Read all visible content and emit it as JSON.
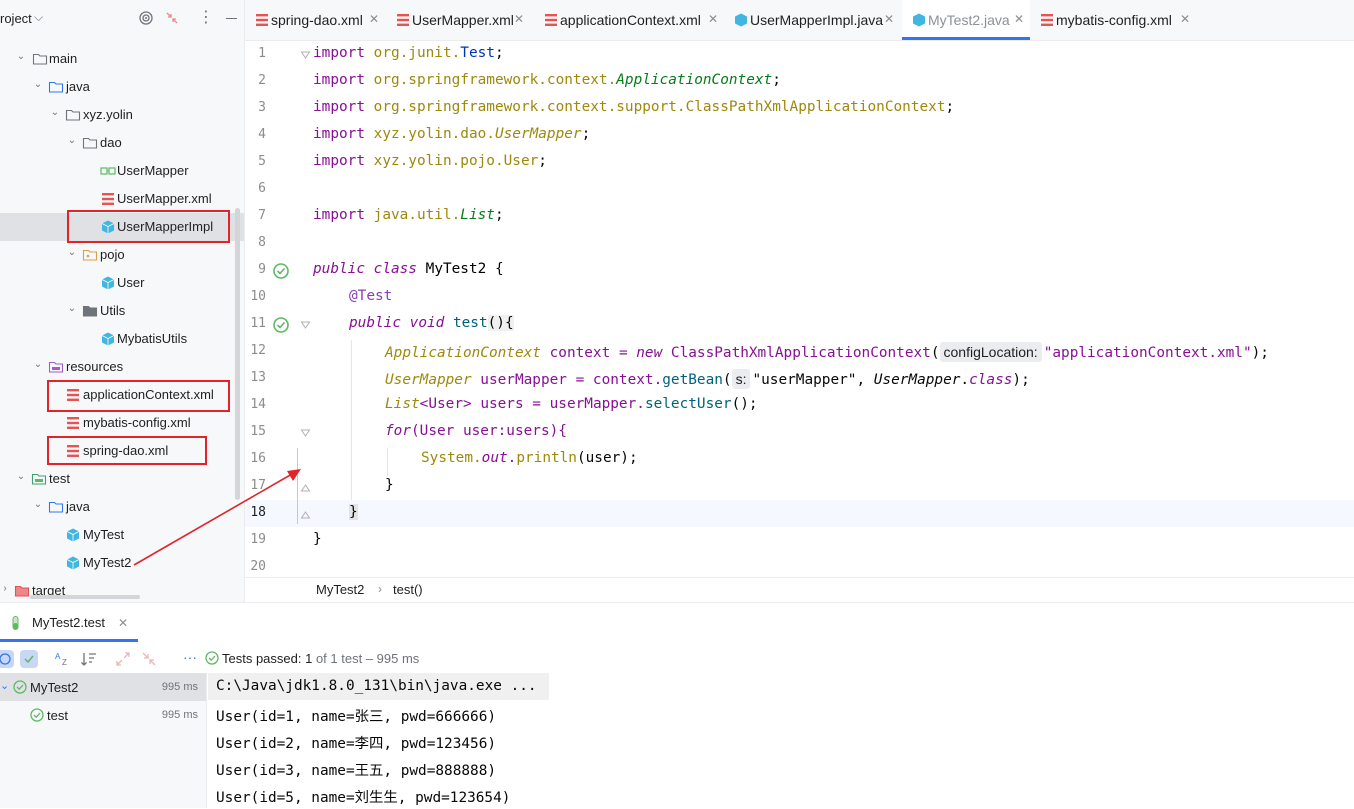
{
  "project": {
    "title": "roject",
    "items": [
      {
        "label": "main",
        "icon": "folder-icon"
      },
      {
        "label": "java",
        "icon": "source-folder-icon"
      },
      {
        "label": "xyz.yolin",
        "icon": "package-icon"
      },
      {
        "label": "dao",
        "icon": "package-icon"
      },
      {
        "label": "UserMapper",
        "icon": "interface-icon"
      },
      {
        "label": "UserMapper.xml",
        "icon": "xml-file-icon"
      },
      {
        "label": "UserMapperImpl",
        "icon": "class-icon"
      },
      {
        "label": "pojo",
        "icon": "package-icon"
      },
      {
        "label": "User",
        "icon": "class-icon"
      },
      {
        "label": "Utils",
        "icon": "package-icon"
      },
      {
        "label": "MybatisUtils",
        "icon": "class-icon"
      },
      {
        "label": "resources",
        "icon": "resources-folder-icon"
      },
      {
        "label": "applicationContext.xml",
        "icon": "xml-file-icon"
      },
      {
        "label": "mybatis-config.xml",
        "icon": "xml-file-icon"
      },
      {
        "label": "spring-dao.xml",
        "icon": "xml-file-icon"
      },
      {
        "label": "test",
        "icon": "test-folder-icon"
      },
      {
        "label": "java",
        "icon": "test-source-folder-icon"
      },
      {
        "label": "MyTest",
        "icon": "test-class-icon"
      },
      {
        "label": "MyTest2",
        "icon": "test-class-icon"
      },
      {
        "label": "target",
        "icon": "excluded-folder-icon"
      }
    ]
  },
  "tabs": [
    {
      "label": "spring-dao.xml",
      "icon": "xml-file-icon"
    },
    {
      "label": "UserMapper.xml",
      "icon": "xml-file-icon"
    },
    {
      "label": "applicationContext.xml",
      "icon": "xml-file-icon"
    },
    {
      "label": "UserMapperImpl.java",
      "icon": "class-icon"
    },
    {
      "label": "MyTest2.java",
      "icon": "test-class-icon"
    },
    {
      "label": "mybatis-config.xml",
      "icon": "xml-file-icon"
    }
  ],
  "editor": {
    "line_numbers": [
      "1",
      "2",
      "3",
      "4",
      "5",
      "6",
      "7",
      "8",
      "9",
      "10",
      "11",
      "12",
      "13",
      "14",
      "15",
      "16",
      "17",
      "18",
      "19",
      "20"
    ],
    "current_line": "18",
    "code": {
      "l1": {
        "kw": "import",
        "pkg": "org.junit.",
        "cls": "Test",
        "end": ";"
      },
      "l2": {
        "kw": "import",
        "pkg": "org.springframework.context.",
        "cls": "ApplicationContext",
        "end": ";"
      },
      "l3": {
        "kw": "import",
        "pkg": "org.springframework.context.support.",
        "cls": "ClassPathXmlApplicationContext",
        "end": ";"
      },
      "l4": {
        "kw": "import",
        "pkg": "xyz.yolin.dao.",
        "cls": "UserMapper",
        "end": ";"
      },
      "l5": {
        "kw": "import",
        "pkg": "xyz.yolin.pojo.",
        "cls": "User",
        "end": ";"
      },
      "l7": {
        "kw": "import",
        "pkg": "java.util.",
        "cls": "List",
        "end": ";"
      },
      "l9": {
        "kw1": "public",
        "kw2": "class",
        "name": "MyTest2",
        "end": " {"
      },
      "l10": {
        "ann": "@Test"
      },
      "l11": {
        "kw1": "public",
        "kw2": "void",
        "name": "test",
        "end": "(){"
      },
      "l12": {
        "type": "ApplicationContext",
        "var": " context ",
        "eq": "= ",
        "kw": "new ",
        "cls": "ClassPathXmlApplicationContext",
        "open": "(",
        "hint": "configLocation:",
        "str": "\"applicationContext.xml\"",
        "end": ");"
      },
      "l13": {
        "type": "UserMapper",
        "var": " userMapper ",
        "eq": "= context.",
        "meth": "getBean",
        "open": "(",
        "hint": "s:",
        "str": "\"userMapper\"",
        "mid": ", ",
        "type2": "UserMapper",
        "dot": ".",
        "kw": "class",
        "end": ");"
      },
      "l14": {
        "type": "List",
        "lt": "<",
        "cls": "User",
        "gt": "> ",
        "var": "users ",
        "eq": "= userMapper.",
        "meth": "selectUser",
        "end": "();"
      },
      "l15": {
        "kw": "for",
        "open": "(User user:users){"
      },
      "l16": {
        "pre": "System.",
        "field": "out",
        "dot": ".",
        "meth": "println",
        "end": "(user);"
      },
      "l17": {
        "text": "}"
      },
      "l18": {
        "text": "}"
      },
      "l19": {
        "text": "}"
      }
    }
  },
  "breadcrumb": {
    "cls": "MyTest2",
    "sep": "›",
    "method": "test()"
  },
  "run": {
    "tab_label": "MyTest2.test",
    "status_prefix": "Tests passed: ",
    "status_count": "1",
    "status_suffix": " of 1 test – 995 ms",
    "tree": [
      {
        "label": "MyTest2",
        "time": "995 ms"
      },
      {
        "label": "test",
        "time": "995 ms"
      }
    ],
    "console": [
      "C:\\Java\\jdk1.8.0_131\\bin\\java.exe ...",
      "User(id=1, name=张三, pwd=666666)",
      "User(id=2, name=李四, pwd=123456)",
      "User(id=3, name=王五, pwd=888888)",
      "User(id=5, name=刘生生, pwd=123654)"
    ]
  },
  "colors": {
    "accent": "#3574f0",
    "highlight_box": "#e0242a",
    "pass": "#5fb865"
  }
}
